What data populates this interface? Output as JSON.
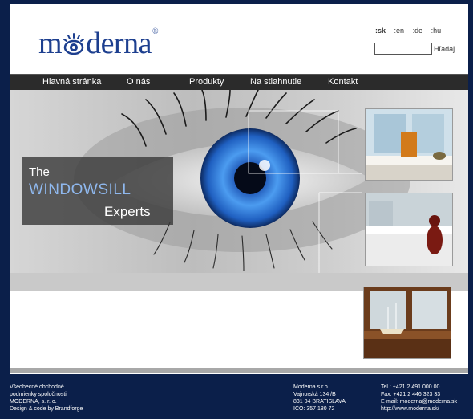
{
  "header": {
    "logo_text_before": "m",
    "logo_text_after": "derna",
    "logo_reg": "®",
    "languages": [
      ":sk",
      ":en",
      ":de",
      ":hu"
    ],
    "active_language": ":sk",
    "search_label": "Hľadaj",
    "search_value": ""
  },
  "nav": {
    "items": [
      "Hlavná stránka",
      "O nás",
      "Produkty",
      "Na stiahnutie",
      "Kontakt"
    ]
  },
  "hero": {
    "tagline_line1": "The",
    "tagline_line2": "WINDOWSILL",
    "tagline_line3": "Experts",
    "accent_color": "#8fb8ee"
  },
  "footer": {
    "col1": [
      "Všeobecné obchodné",
      "podmienky spoločnosti",
      "MODERNA, s. r. o.",
      "Design & code by Brandforge"
    ],
    "col2": [
      "Moderna s.r.o.",
      "Vajnorská 134 /B",
      "831 04 BRATISLAVA",
      "IČO: 357 180 72"
    ],
    "col3": [
      "Tel.: +421 2 491 000 00",
      "Fax: +421 2 446 323 33",
      "E-mail: moderna@moderna.sk",
      "http://www.moderna.sk/"
    ]
  },
  "colors": {
    "frame": "#0b1f4a",
    "brand": "#1d3f8f",
    "nav_bg": "#2b2b2b"
  }
}
